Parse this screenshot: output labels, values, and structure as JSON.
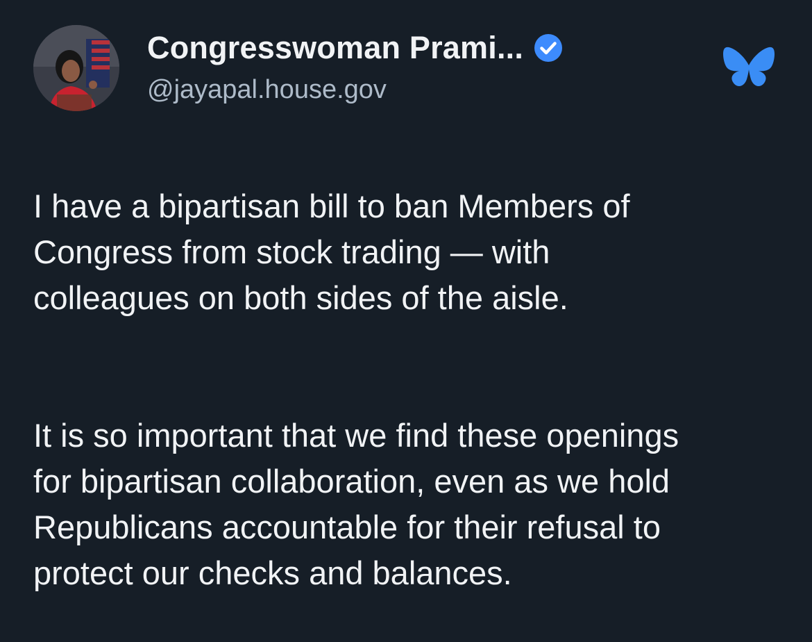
{
  "post": {
    "author": {
      "display_name": "Congresswoman Prami...",
      "handle": "@jayapal.house.gov",
      "verified": true
    },
    "app_icon": "bluesky-butterfly-icon",
    "paragraphs": [
      "I have a bipartisan bill to ban Members of\nCongress from stock trading — with\ncolleagues on both sides of the aisle.",
      "It is so important that we find these openings\nfor bipartisan collaboration, even as we hold\nRepublicans accountable for their refusal to\nprotect our checks and balances."
    ]
  },
  "colors": {
    "background": "#161e27",
    "text": "#f1f3f5",
    "handle": "#aebbc9",
    "verified_badge": "#3d8bfd",
    "brand": "#3a8df5"
  }
}
